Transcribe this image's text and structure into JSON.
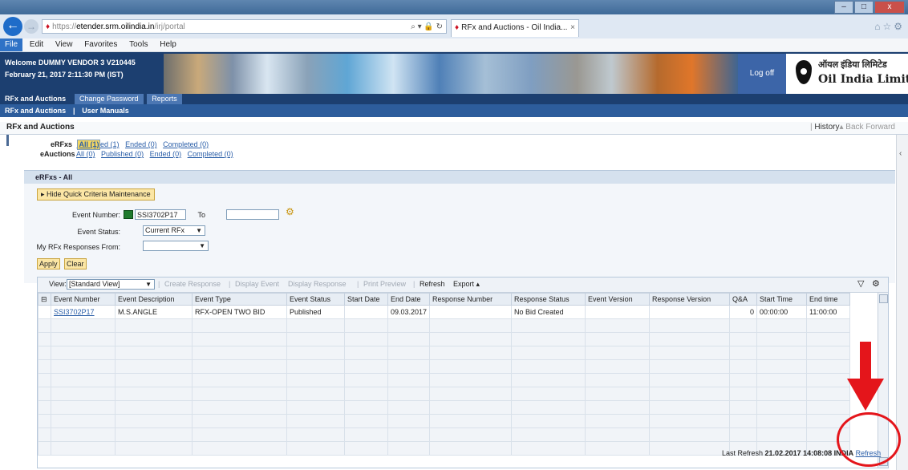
{
  "browser": {
    "url_scheme": "https://",
    "url_host": "etender.srm.oilindia.in",
    "url_path": "/irj/portal",
    "tab_title": "RFx and Auctions - Oil India...",
    "menu": [
      "File",
      "Edit",
      "View",
      "Favorites",
      "Tools",
      "Help"
    ],
    "window_controls": [
      "–",
      "□",
      "x"
    ]
  },
  "header": {
    "welcome": "Welcome DUMMY VENDOR 3 V210445",
    "datetime": "February 21, 2017  2:11:30 PM (IST)",
    "logoff": "Log off",
    "logo_hindi": "ऑयल इंडिया लिमिटेड",
    "logo_english": "Oil India Limited"
  },
  "nav": {
    "tabs": [
      "RFx and Auctions",
      "Change Password",
      "Reports"
    ],
    "sub": [
      "RFx and Auctions",
      "|",
      "User Manuals"
    ]
  },
  "page": {
    "title": "RFx and Auctions",
    "history": "History",
    "back": "Back",
    "forward": "Forward"
  },
  "quicklinks": {
    "erfx_label": "eRFxs",
    "erfx": [
      "All (1)",
      "Published (1)",
      "Ended (0)",
      "Completed (0)"
    ],
    "eauction_label": "eAuctions",
    "eauction": [
      "All (0)",
      "Published (0)",
      "Ended (0)",
      "Completed (0)"
    ]
  },
  "section": {
    "title": "eRFxs - All",
    "hide_btn": "▸ Hide Quick Criteria Maintenance"
  },
  "criteria": {
    "event_number_label": "Event Number:",
    "event_number_value": "SSI3702P17",
    "to_label": "To",
    "to_value": "",
    "event_status_label": "Event Status:",
    "event_status_value": "Current RFx",
    "responses_from_label": "My RFx Responses From:",
    "responses_from_value": "",
    "apply": "Apply",
    "clear": "Clear"
  },
  "toolbar": {
    "view_label": "View:",
    "view_value": "[Standard View]",
    "create_response": "Create Response",
    "display_event": "Display Event",
    "display_response": "Display Response",
    "print_preview": "Print Preview",
    "refresh": "Refresh",
    "export": "Export ▴"
  },
  "table": {
    "columns": [
      "Event Number",
      "Event Description",
      "Event Type",
      "Event Status",
      "Start Date",
      "End Date",
      "Response Number",
      "Response Status",
      "Event Version",
      "Response Version",
      "Q&A",
      "Start Time",
      "End time"
    ],
    "rows": [
      [
        "SSI3702P17",
        "M.S.ANGLE",
        "RFX-OPEN TWO BID",
        "Published",
        "",
        "09.03.2017",
        "",
        "No Bid Created",
        "",
        "",
        "0",
        "00:00:00",
        "11:00:00"
      ]
    ]
  },
  "footer": {
    "last_refresh_label": "Last Refresh",
    "last_refresh_value": "21.02.2017 14:08:08 INDIA",
    "refresh_link": "Refresh"
  },
  "annotation": {
    "arrow_color": "#e4151b"
  }
}
